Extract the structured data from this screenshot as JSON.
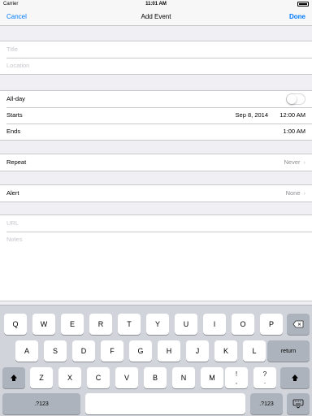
{
  "status": {
    "carrier": "Carrier",
    "time": "11:01 AM"
  },
  "nav": {
    "cancel": "Cancel",
    "title": "Add Event",
    "done": "Done"
  },
  "fields": {
    "title_placeholder": "Title",
    "location_placeholder": "Location"
  },
  "allday": {
    "label": "All-day",
    "on": false
  },
  "starts": {
    "label": "Starts",
    "date": "Sep 8, 2014",
    "time": "12:00 AM"
  },
  "ends": {
    "label": "Ends",
    "time": "1:00 AM"
  },
  "repeat": {
    "label": "Repeat",
    "value": "Never"
  },
  "alert": {
    "label": "Alert",
    "value": "None"
  },
  "url": {
    "placeholder": "URL"
  },
  "notes": {
    "placeholder": "Notes"
  },
  "keyboard": {
    "row1": [
      "Q",
      "W",
      "E",
      "R",
      "T",
      "Y",
      "U",
      "I",
      "O",
      "P"
    ],
    "row2": [
      "A",
      "S",
      "D",
      "F",
      "G",
      "H",
      "J",
      "K",
      "L"
    ],
    "row3": [
      "Z",
      "X",
      "C",
      "V",
      "B",
      "N",
      "M"
    ],
    "punct1_top": "!",
    "punct1_bottom": ",",
    "punct2_top": "?",
    "punct2_bottom": ".",
    "return": "return",
    "numbers": ".?123",
    "icons": {
      "backspace": "backspace-icon",
      "shift": "shift-icon",
      "dismiss": "keyboard-dismiss-icon"
    }
  }
}
